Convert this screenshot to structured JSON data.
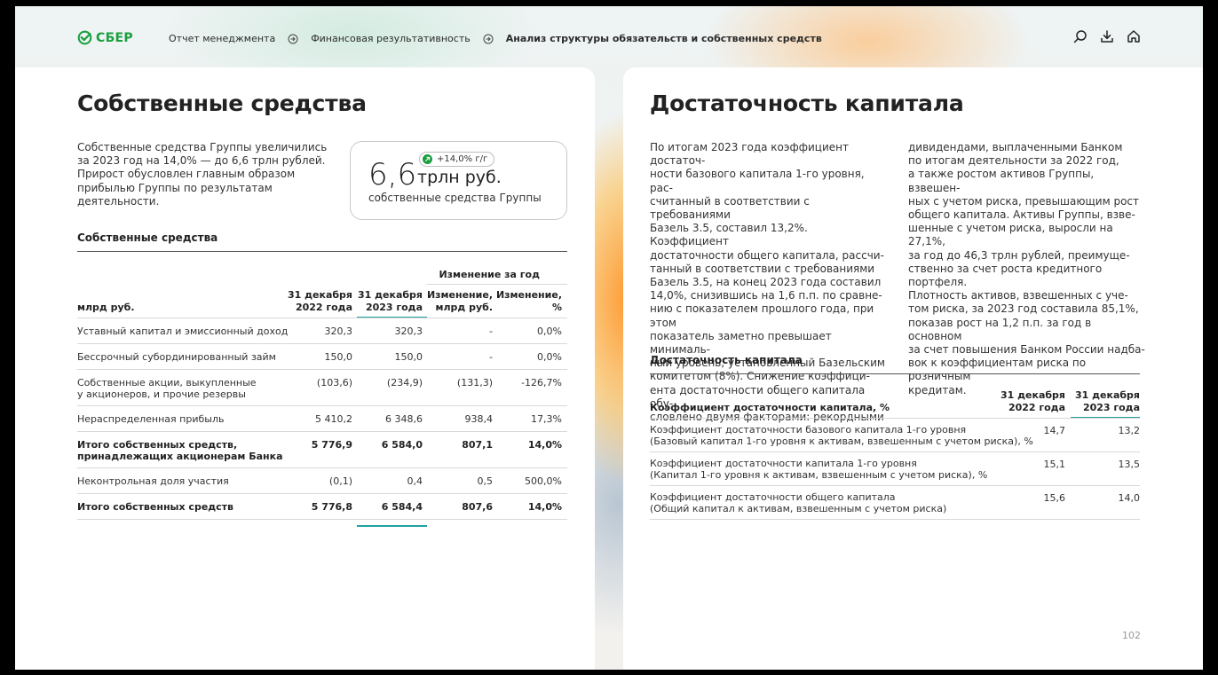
{
  "header": {
    "logo_text": "СБЕР",
    "breadcrumbs": [
      "Отчет менеджмента",
      "Финансовая результативность",
      "Анализ структуры обязательств и собственных средств"
    ]
  },
  "left": {
    "title": "Собственные средства",
    "intro": [
      "Собственные средства Группы увеличились",
      "за 2023 год на 14,0% — до 6,6 трлн рублей.",
      "Прирост обусловлен главным образом",
      "прибылью Группы по результатам",
      "деятельности."
    ],
    "kpi": {
      "badge": "+14,0% г/г",
      "value": "6,6",
      "unit": "трлн руб.",
      "label": "собственные средства Группы"
    },
    "table_title": "Собственные средства",
    "table": {
      "group_header": "Изменение за год",
      "unit_label": "млрд руб.",
      "columns": [
        [
          "31 декабря",
          "2022 года"
        ],
        [
          "31 декабря",
          "2023 года"
        ],
        [
          "Изменение,",
          "млрд руб."
        ],
        [
          "Изменение,",
          "%"
        ]
      ],
      "rows": [
        {
          "label": [
            "Уставный капитал и эмиссионный доход"
          ],
          "values": [
            "320,3",
            "320,3",
            "-",
            "0,0%"
          ],
          "bold": false
        },
        {
          "label": [
            "Бессрочный субординированный займ"
          ],
          "values": [
            "150,0",
            "150,0",
            "-",
            "0,0%"
          ],
          "bold": false
        },
        {
          "label": [
            "Собственные акции, выкупленные",
            "у акционеров, и прочие резервы"
          ],
          "values": [
            "(103,6)",
            "(234,9)",
            "(131,3)",
            "-126,7%"
          ],
          "bold": false
        },
        {
          "label": [
            "Нераспределенная прибыль"
          ],
          "values": [
            "5 410,2",
            "6 348,6",
            "938,4",
            "17,3%"
          ],
          "bold": false
        },
        {
          "label": [
            "Итого собственных средств,",
            "принадлежащих акционерам Банка"
          ],
          "values": [
            "5 776,9",
            "6 584,0",
            "807,1",
            "14,0%"
          ],
          "bold": true
        },
        {
          "label": [
            "Неконтрольная доля участия"
          ],
          "values": [
            "(0,1)",
            "0,4",
            "0,5",
            "500,0%"
          ],
          "bold": false
        },
        {
          "label": [
            "Итого собственных средств"
          ],
          "values": [
            "5 776,8",
            "6 584,4",
            "807,6",
            "14,0%"
          ],
          "bold": true
        }
      ]
    }
  },
  "right": {
    "title": "Достаточность капитала",
    "col1": [
      "По итогам 2023 года коэффициент достаточ-",
      "ности базового капитала 1-го уровня, рас-",
      "считанный в соответствии с требованиями",
      "Базель 3.5, составил 13,2%. Коэффициент",
      "достаточности общего капитала, рассчи-",
      "танный в соответствии с требованиями",
      "Базель 3.5, на конец 2023 года составил",
      "14,0%, снизившись на 1,6 п.п. по сравне-",
      "нию с показателем прошлого года, при этом",
      "показатель заметно превышает минималь-",
      "ный уровень, установленный Базельским",
      "комитетом (8%). Снижение коэффици-",
      "ента достаточности общего капитала обу-",
      "словлено двумя факторами: рекордными"
    ],
    "col2": [
      "дивидендами, выплаченными Банком",
      "по итогам деятельности за 2022 год,",
      "а также ростом активов Группы, взвешен-",
      "ных с учетом риска, превышающим рост",
      "общего капитала. Активы Группы, взве-",
      "шенные с учетом риска, выросли на 27,1%,",
      "за год до 46,3 трлн рублей, преимуще-",
      "ственно за счет роста кредитного портфеля.",
      "Плотность активов, взвешенных с уче-",
      "том риска, за 2023 год составила 85,1%,",
      "показав рост на 1,2 п.п. за год в основном",
      "за счет повышения Банком России надба-",
      "вок к коэффициентам риска по розничным",
      "кредитам."
    ],
    "table_title": "Достаточность капитала",
    "table": {
      "header_label": "Коэффициент достаточности капитала, %",
      "columns": [
        [
          "31 декабря",
          "2022 года"
        ],
        [
          "31 декабря",
          "2023 года"
        ]
      ],
      "rows": [
        {
          "label": [
            "Коэффициент достаточности базового капитала 1-го уровня",
            "(Базовый капитал 1-го уровня к активам, взвешенным с учетом риска), %"
          ],
          "values": [
            "14,7",
            "13,2"
          ]
        },
        {
          "label": [
            "Коэффициент достаточности капитала 1-го уровня",
            "(Капитал 1-го уровня к активам, взвешенным с учетом риска), %"
          ],
          "values": [
            "15,1",
            "13,5"
          ]
        },
        {
          "label": [
            "Коэффициент достаточности общего капитала",
            "(Общий капитал к активам, взвешенным с учетом риска)"
          ],
          "values": [
            "15,6",
            "14,0"
          ]
        }
      ]
    }
  },
  "page_number": "102",
  "colors": {
    "brand_green": "#1a9f3e",
    "accent_teal": "#21a1a0"
  }
}
